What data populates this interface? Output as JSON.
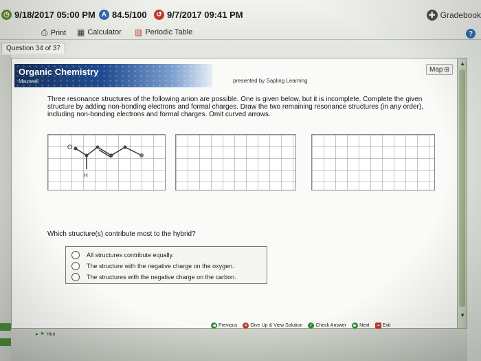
{
  "toolbar": {
    "due_date": "9/18/2017 05:00 PM",
    "score": "84.5/100",
    "submitted": "9/7/2017 09:41 PM",
    "print_label": "Print",
    "calculator_label": "Calculator",
    "periodic_table_label": "Periodic Table",
    "gradebook_label": "Gradebook",
    "help_label": "?"
  },
  "question_tab": "Question 34 of 37",
  "header": {
    "title": "Organic Chemistry",
    "subtitle": "Maxwell",
    "presented_by": "presented by Sapling Learning",
    "map_label": "Map"
  },
  "instructions": "Three resonance structures of the following anion are possible. One is given below, but it is incomplete. Complete the given structure by adding non-bonding electrons and formal charges. Draw the two remaining resonance structures (in any order), including non-bonding electrons and formal charges. Omit curved arrows.",
  "molecule": {
    "atom_o": "O",
    "atom_h": "H"
  },
  "question": {
    "prompt": "Which structure(s) contribute most to the hybrid?",
    "options": [
      "All structures contribute equally.",
      "The structure with the negative charge on the oxygen.",
      "The structures with the negative charge on the carbon."
    ]
  },
  "footer": {
    "previous": "Previous",
    "give_up": "Give Up & View Solution",
    "check_answer": "Check Answer",
    "next": "Next",
    "exit": "Exit",
    "hint": "Hint"
  },
  "colors": {
    "banner_dark": "#16325f",
    "banner_light": "#7da0cf",
    "accent_green": "#2e8b2e",
    "accent_red": "#c0392b",
    "accent_blue": "#2b6cb0"
  }
}
